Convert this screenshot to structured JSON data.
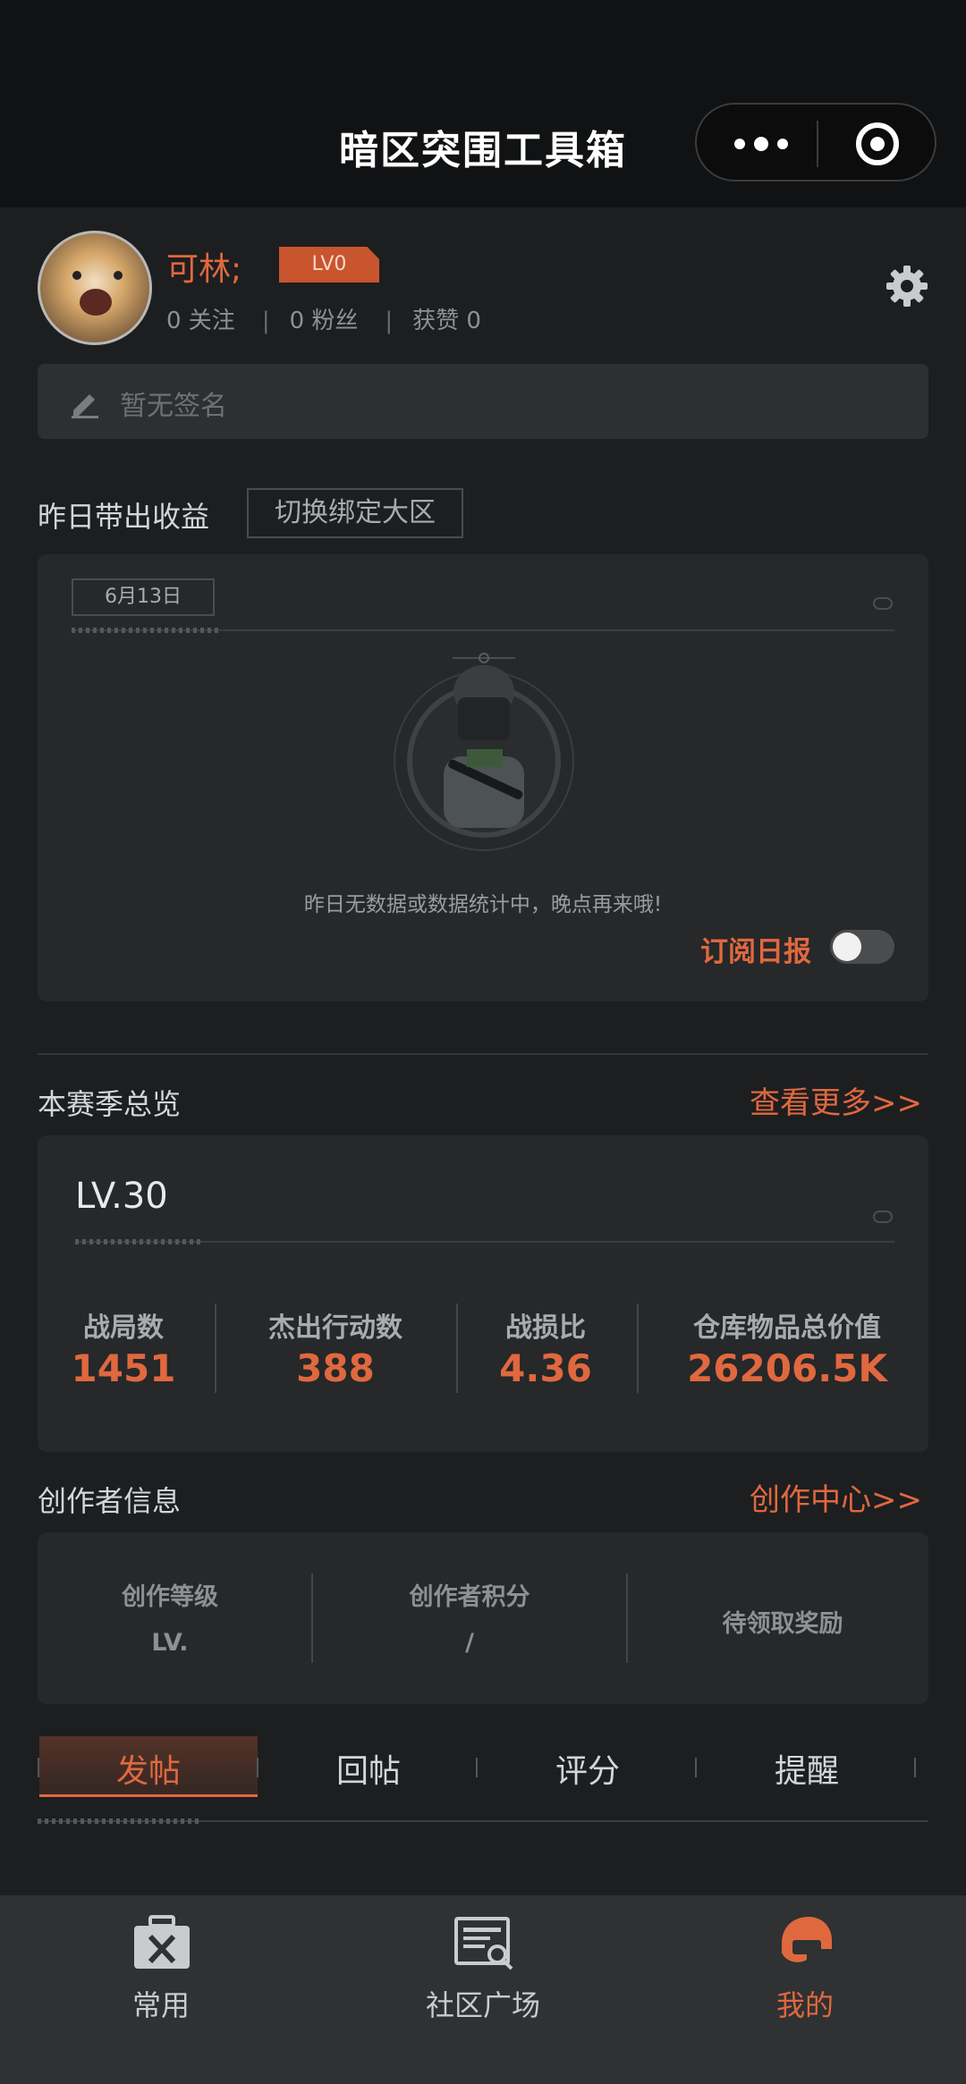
{
  "header": {
    "title": "暗区突围工具箱"
  },
  "profile": {
    "username": "可林;",
    "level_badge": "LV0",
    "following": "0 关注",
    "fans": "0 粉丝",
    "likes": "获赞 0",
    "signature_placeholder": "暂无签名"
  },
  "yesterday": {
    "title": "昨日带出收益",
    "switch_label": "切换绑定大区",
    "date": "6月13日",
    "empty_text": "昨日无数据或数据统计中，晚点再来哦!",
    "subscribe_label": "订阅日报",
    "subscribe_on": false
  },
  "season": {
    "title": "本赛季总览",
    "more_label": "查看更多>>",
    "level": "LV.30",
    "stats": [
      {
        "label": "战局数",
        "value": "1451"
      },
      {
        "label": "杰出行动数",
        "value": "388"
      },
      {
        "label": "战损比",
        "value": "4.36"
      },
      {
        "label": "仓库物品总价值",
        "value": "26206.5K"
      }
    ]
  },
  "creator": {
    "title": "创作者信息",
    "center_label": "创作中心>>",
    "level_label": "创作等级",
    "level_value": "LV.",
    "points_label": "创作者积分",
    "points_value": "/",
    "reward_label": "待领取奖励"
  },
  "tabs": [
    {
      "label": "发帖",
      "active": true
    },
    {
      "label": "回帖",
      "active": false
    },
    {
      "label": "评分",
      "active": false
    },
    {
      "label": "提醒",
      "active": false
    }
  ],
  "bottom_nav": [
    {
      "label": "常用",
      "icon": "toolbox-icon",
      "active": false
    },
    {
      "label": "社区广场",
      "icon": "community-icon",
      "active": false
    },
    {
      "label": "我的",
      "icon": "helmet-icon",
      "active": true
    }
  ],
  "colors": {
    "accent": "#e0683f",
    "background": "#1d1e1f",
    "card": "#262829"
  }
}
